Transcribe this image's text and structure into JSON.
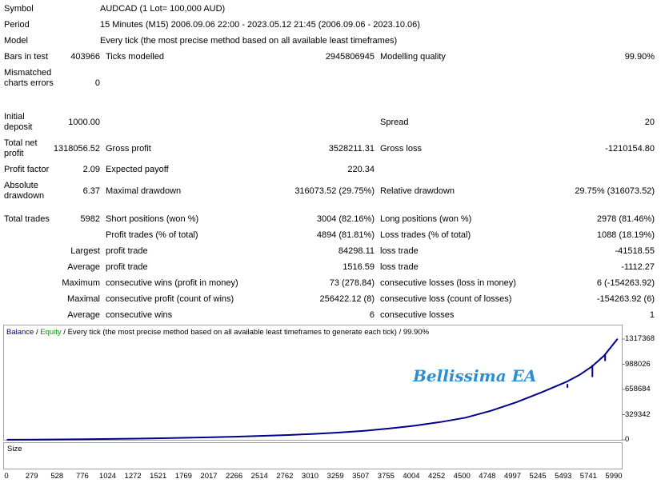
{
  "report": {
    "symbol_label": "Symbol",
    "symbol_value": "AUDCAD (1 Lot= 100,000 AUD)",
    "period_label": "Period",
    "period_value": "15 Minutes (M15) 2006.09.06 22:00 - 2023.05.12 21:45 (2006.09.06 - 2023.10.06)",
    "model_label": "Model",
    "model_value": "Every tick (the most precise method based on all available least timeframes)",
    "bars_label": "Bars in test",
    "bars_value": "403966",
    "ticks_label": "Ticks modelled",
    "ticks_value": "2945806945",
    "quality_label": "Modelling quality",
    "quality_value": "99.90%",
    "mismatch_label": "Mismatched charts errors",
    "mismatch_value": "0",
    "deposit_label": "Initial deposit",
    "deposit_value": "1000.00",
    "spread_label": "Spread",
    "spread_value": "20",
    "netprofit_label": "Total net profit",
    "netprofit_value": "1318056.52",
    "grossprofit_label": "Gross profit",
    "grossprofit_value": "3528211.31",
    "grossloss_label": "Gross loss",
    "grossloss_value": "-1210154.80",
    "pf_label": "Profit factor",
    "pf_value": "2.09",
    "payoff_label": "Expected payoff",
    "payoff_value": "220.34",
    "absdd_label": "Absolute drawdown",
    "absdd_value": "6.37",
    "maxdd_label": "Maximal drawdown",
    "maxdd_value": "316073.52 (29.75%)",
    "reldd_label": "Relative drawdown",
    "reldd_value": "29.75% (316073.52)",
    "trades_label": "Total trades",
    "trades_value": "5982",
    "short_label": "Short positions (won %)",
    "short_value": "3004 (82.16%)",
    "long_label": "Long positions (won %)",
    "long_value": "2978 (81.46%)",
    "profittr_label": "Profit trades (% of total)",
    "profittr_value": "4894 (81.81%)",
    "losstr_label": "Loss trades (% of total)",
    "losstr_value": "1088 (18.19%)",
    "largest_label": "Largest",
    "largest_profit_label": "profit trade",
    "largest_profit_value": "84298.11",
    "largest_loss_label": "loss trade",
    "largest_loss_value": "-41518.55",
    "average_label": "Average",
    "average_profit_label": "profit trade",
    "average_profit_value": "1516.59",
    "average_loss_label": "loss trade",
    "average_loss_value": "-1112.27",
    "maximum_label": "Maximum",
    "max_wins_label": "consecutive wins (profit in money)",
    "max_wins_value": "73 (278.84)",
    "max_losses_label": "consecutive losses (loss in money)",
    "max_losses_value": "6 (-154263.92)",
    "maximal_label": "Maximal",
    "maximal_profit_label": "consecutive profit (count of wins)",
    "maximal_profit_value": "256422.12 (8)",
    "maximal_loss_label": "consecutive loss (count of losses)",
    "maximal_loss_value": "-154263.92 (6)",
    "avgcons_label": "Average",
    "avg_wins_label": "consecutive wins",
    "avg_wins_value": "6",
    "avg_losses_label": "consecutive losses",
    "avg_losses_value": "1"
  },
  "chart_data": {
    "type": "line",
    "legend_balance": "Balance",
    "legend_sep": " / ",
    "legend_equity": "Equity",
    "legend_rest": " / Every tick (the most precise method based on all available least timeframes to generate each tick) / 99.90%",
    "watermark": "Bellissima EA",
    "volume_label": "Size",
    "y_ticks": [
      "1317368",
      "988026",
      "658684",
      "329342",
      "0"
    ],
    "x_ticks": [
      "0",
      "279",
      "528",
      "776",
      "1024",
      "1272",
      "1521",
      "1769",
      "2017",
      "2266",
      "2514",
      "2762",
      "3010",
      "3259",
      "3507",
      "3755",
      "4004",
      "4252",
      "4500",
      "4748",
      "4997",
      "5245",
      "5493",
      "5741",
      "5990"
    ],
    "xlim": [
      0,
      6010
    ],
    "ylim": [
      0,
      1317368
    ],
    "series": [
      {
        "name": "Balance",
        "color": "#00008b",
        "x": [
          0,
          279,
          528,
          776,
          1024,
          1272,
          1521,
          1769,
          2017,
          2266,
          2514,
          2762,
          3010,
          3259,
          3507,
          3755,
          4004,
          4252,
          4500,
          4748,
          4997,
          5245,
          5493,
          5620,
          5741,
          5860,
          5990
        ],
        "y": [
          1000,
          2500,
          5000,
          8000,
          12000,
          16000,
          21000,
          27000,
          34000,
          42000,
          52000,
          63000,
          77000,
          95000,
          118000,
          148000,
          185000,
          232000,
          290000,
          380000,
          490000,
          620000,
          760000,
          850000,
          960000,
          1100000,
          1317368
        ]
      }
    ],
    "dips": [
      {
        "x": 5500,
        "y0": 730000,
        "y1": 680000
      },
      {
        "x": 5745,
        "y0": 980000,
        "y1": 820000
      },
      {
        "x": 5870,
        "y0": 1110000,
        "y1": 1030000
      }
    ],
    "volume_color": "#00a000",
    "volume": [
      {
        "x": 4800,
        "v": 0.1
      },
      {
        "x": 4900,
        "v": 0.12
      },
      {
        "x": 5000,
        "v": 0.15
      },
      {
        "x": 5100,
        "v": 0.15
      },
      {
        "x": 5200,
        "v": 0.18
      },
      {
        "x": 5300,
        "v": 0.2
      },
      {
        "x": 5330,
        "v": 0.45
      },
      {
        "x": 5400,
        "v": 0.22
      },
      {
        "x": 5480,
        "v": 0.3
      },
      {
        "x": 5540,
        "v": 0.5
      },
      {
        "x": 5600,
        "v": 0.3
      },
      {
        "x": 5680,
        "v": 0.35
      },
      {
        "x": 5700,
        "v": 0.95
      },
      {
        "x": 5760,
        "v": 0.45
      },
      {
        "x": 5800,
        "v": 0.5
      },
      {
        "x": 5840,
        "v": 0.95
      },
      {
        "x": 5880,
        "v": 0.55
      },
      {
        "x": 5940,
        "v": 0.6
      },
      {
        "x": 5975,
        "v": 0.95
      },
      {
        "x": 5995,
        "v": 0.35
      }
    ]
  }
}
